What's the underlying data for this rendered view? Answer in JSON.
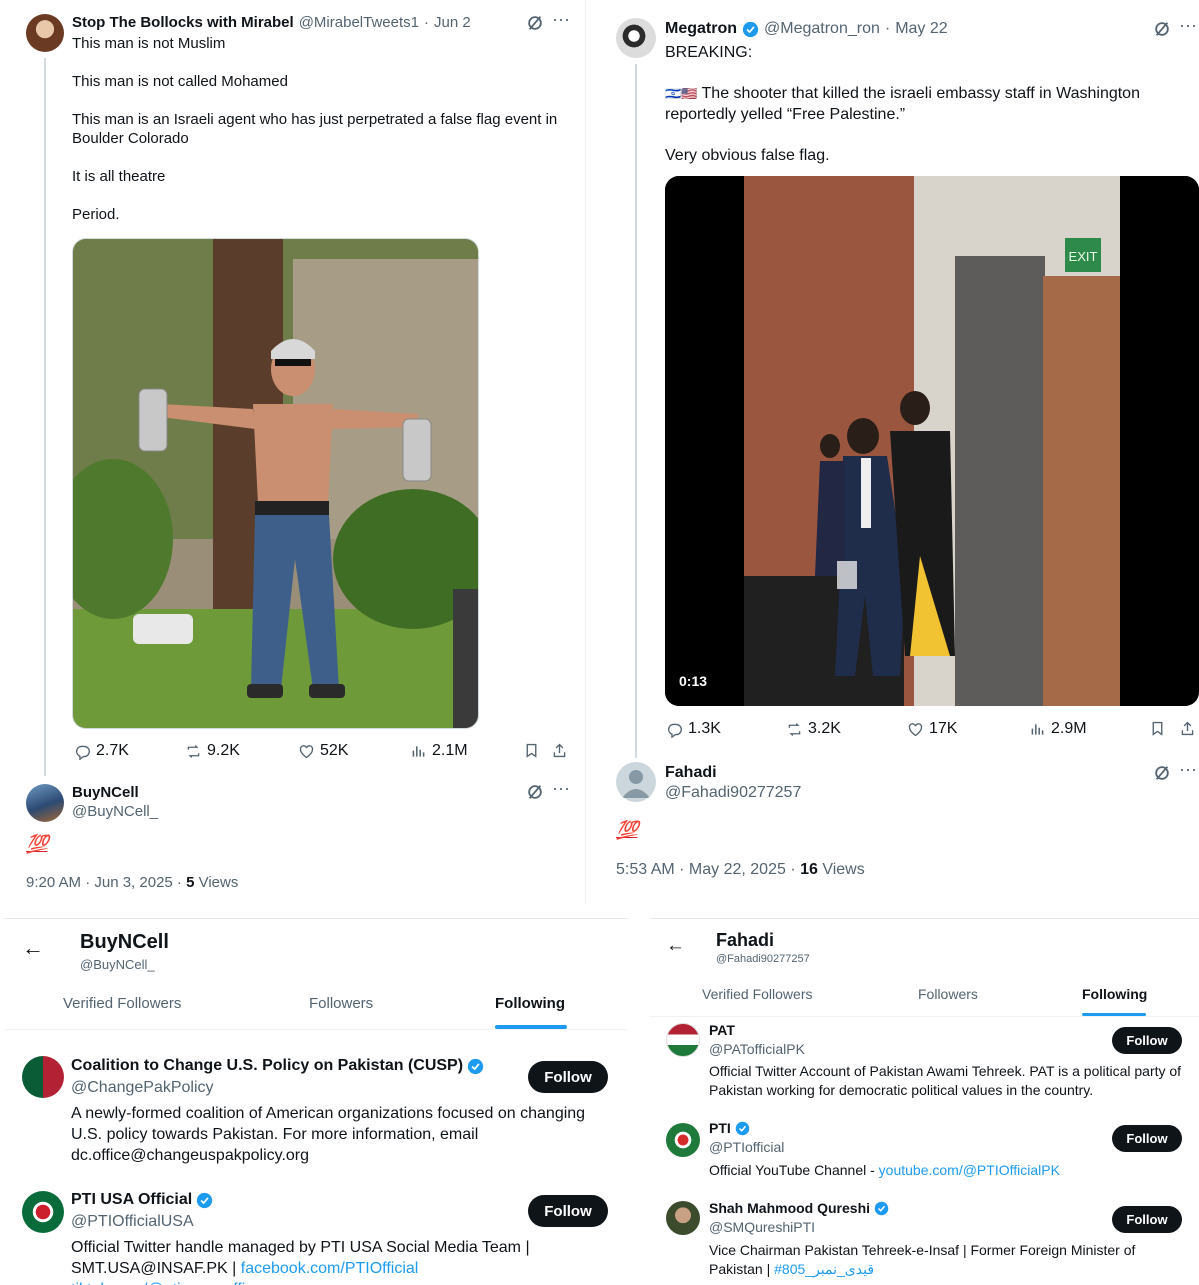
{
  "tweet_left": {
    "author": "Stop The Bollocks with Mirabel",
    "handle": "@MirabelTweets1",
    "date": "Jun 2",
    "lines": [
      "This man is not Muslim",
      "This man is not called Mohamed",
      "This man is an Israeli agent who has just perpetrated a false flag event in Boulder Colorado",
      "It is all theatre",
      "Period."
    ],
    "stats": {
      "replies": "2.7K",
      "reposts": "9.2K",
      "likes": "52K",
      "views": "2.1M"
    },
    "reply": {
      "author": "BuyNCell",
      "handle": "@BuyNCell_",
      "emoji": "💯",
      "time": "9:20 AM · Jun 3, 2025 · ",
      "views_count": "5",
      "views_label": " Views"
    }
  },
  "tweet_right": {
    "author": "Megatron",
    "handle": "@Megatron_ron",
    "date": "May 22",
    "headline": "BREAKING:",
    "flags": "🇮🇱🇺🇸",
    "body": "The shooter that killed the israeli embassy staff in Washington reportedly yelled “Free Palestine.”",
    "closing": "Very obvious false flag.",
    "video_duration": "0:13",
    "video_sign": "EXIT",
    "stats": {
      "replies": "1.3K",
      "reposts": "3.2K",
      "likes": "17K",
      "views": "2.9M"
    },
    "reply": {
      "author": "Fahadi",
      "handle": "@Fahadi90277257",
      "emoji": "💯",
      "time": "5:53 AM · May 22, 2025 · ",
      "views_count": "16",
      "views_label": " Views"
    }
  },
  "profile_left": {
    "name": "BuyNCell",
    "handle": "@BuyNCell_",
    "tabs": [
      "Verified Followers",
      "Followers",
      "Following"
    ],
    "active_tab": "Following",
    "accounts": [
      {
        "name": "Coalition to Change U.S. Policy on Pakistan (CUSP)",
        "handle": "@ChangePakPolicy",
        "bio": "A newly-formed coalition of American organizations focused on changing U.S. policy towards Pakistan. For more information, email dc.office@changeuspakpolicy.org",
        "button": "Follow"
      },
      {
        "name": "PTI USA Official",
        "handle": "@PTIOfficialUSA",
        "bio": "Official Twitter handle managed by PTI USA Social Media Team | SMT.USA@INSAF.PK | ",
        "bio_link": "facebook.com/PTIOfficial tiktok.com/@pti_usa_offic...",
        "button": "Follow"
      }
    ]
  },
  "profile_right": {
    "name": "Fahadi",
    "handle": "@Fahadi90277257",
    "tabs": [
      "Verified Followers",
      "Followers",
      "Following"
    ],
    "active_tab": "Following",
    "accounts": [
      {
        "name": "PAT",
        "handle": "@PATofficialPK",
        "bio": "Official Twitter Account of Pakistan Awami Tehreek. PAT is a political party of Pakistan working for democratic political values in the country.",
        "button": "Follow"
      },
      {
        "name": "PTI",
        "handle": "@PTIofficial",
        "bio": "Official YouTube Channel - ",
        "bio_link": "youtube.com/@PTIOfficialPK",
        "button": "Follow"
      },
      {
        "name": "Shah Mahmood Qureshi",
        "handle": "@SMQureshiPTI",
        "bio": "Vice Chairman Pakistan Tehreek-e-Insaf | Former Foreign Minister of Pakistan | ",
        "bio_link": "#قیدی_نمبر_805",
        "button": "Follow"
      }
    ]
  },
  "colors": {
    "verified": "#1d9bf0",
    "text": "#0f1419",
    "muted": "#536471",
    "link": "#1d9bf0"
  },
  "icons": [
    "back-arrow-icon",
    "verified-icon",
    "grok-icon",
    "more-icon",
    "reply-icon",
    "repost-icon",
    "like-icon",
    "views-icon",
    "bookmark-icon",
    "share-icon"
  ]
}
